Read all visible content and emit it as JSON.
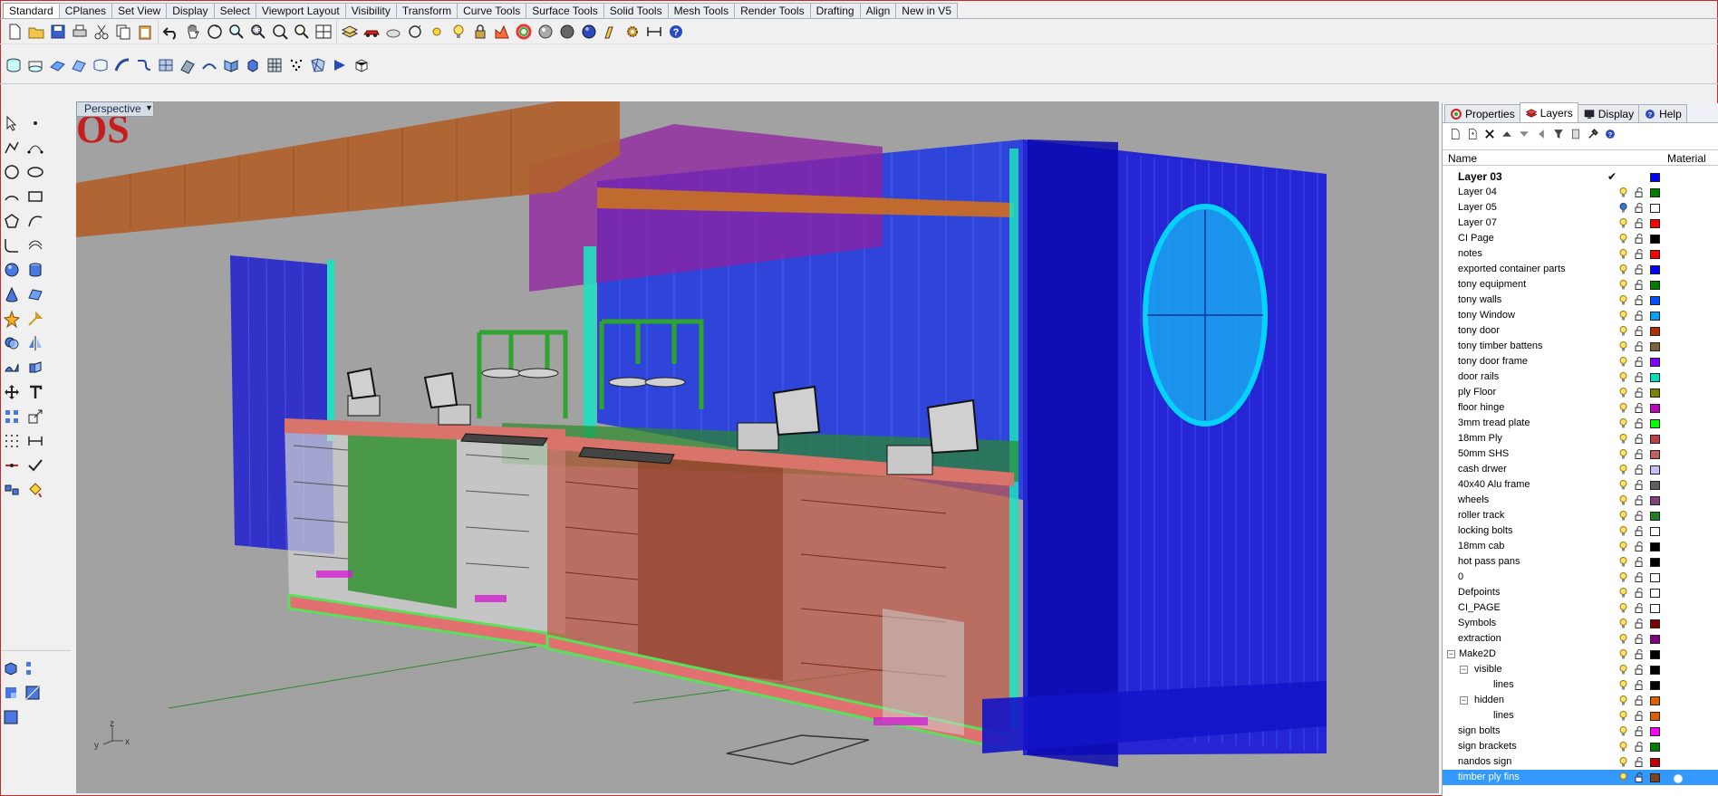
{
  "tabs": [
    "Standard",
    "CPlanes",
    "Set View",
    "Display",
    "Select",
    "Viewport Layout",
    "Visibility",
    "Transform",
    "Curve Tools",
    "Surface Tools",
    "Solid Tools",
    "Mesh Tools",
    "Render Tools",
    "Drafting",
    "Align",
    "New in V5"
  ],
  "active_tab": "Standard",
  "toolbar_row1": [
    "new-file-icon",
    "open-file-icon",
    "save-icon",
    "print-icon",
    "cut-icon",
    "copy-icon",
    "paste-icon",
    "undo-icon",
    "pan-hand-icon",
    "rotate-view-icon",
    "zoom-icon",
    "zoom-window-icon",
    "zoom-extents-icon",
    "zoom-selected-icon",
    "viewport-layout-icon",
    "layer-icon",
    "car-render-icon",
    "shade-icon",
    "rotate-icon",
    "lights-icon",
    "lightbulb-icon",
    "lock-icon",
    "analysis-icon",
    "color-wheel-icon",
    "rendered-sphere-icon",
    "shaded-sphere-icon",
    "render-icon",
    "highlight-icon",
    "settings-gear-icon",
    "dimension-icon",
    "help-icon"
  ],
  "toolbar_row2": [
    "extrude-curve-icon",
    "extrude-surface-icon",
    "plane-icon",
    "surface-patch-icon",
    "loft-icon",
    "sweep-icon",
    "blend-icon",
    "network-surface-icon",
    "unroll-icon",
    "flow-icon",
    "split-surface-icon",
    "box-icon",
    "grid-icon",
    "point-cloud-icon",
    "mesh-icon",
    "arrow-icon",
    "solid-box-icon"
  ],
  "left_tools": [
    "select-arrow-icon",
    "point-icon",
    "polyline-icon",
    "curve-points-icon",
    "circle-icon",
    "ellipse-icon",
    "arc-icon",
    "rectangle-icon",
    "polygon-icon",
    "curve-icon",
    "fillet-icon",
    "offset-icon",
    "sphere-icon",
    "cylinder-icon",
    "cone-icon",
    "surface-icon",
    "star-burst-icon",
    "arrow-pick-icon",
    "boolean-icon",
    "mirror-icon",
    "drape-icon",
    "extrude-icon",
    "move-icon",
    "text-icon",
    "array-icon",
    "scale-icon",
    "grid-snap-icon",
    "dimension-icon",
    "join-icon",
    "check-icon",
    "explode-icon",
    "paint-icon"
  ],
  "left_tools_bottom": [
    "solid-cube-icon",
    "edit-points-icon",
    "dots-icon",
    "frame-icon",
    "graph-icon"
  ],
  "viewport": {
    "title": "Perspective",
    "axis_x": "x",
    "axis_y": "y",
    "axis_z": "z"
  },
  "panel": {
    "tabs": [
      {
        "label": "Properties",
        "icon": "properties-icon"
      },
      {
        "label": "Layers",
        "icon": "layers-icon"
      },
      {
        "label": "Display",
        "icon": "display-icon"
      },
      {
        "label": "Help",
        "icon": "help-icon"
      }
    ],
    "active_tab": "Layers",
    "tools": [
      "new-layer-icon",
      "new-sublayer-icon",
      "delete-icon",
      "move-up-icon",
      "move-down-icon",
      "move-parent-icon",
      "filter-icon",
      "notes-icon",
      "tools-icon",
      "help-icon"
    ],
    "col_name": "Name",
    "col_material": "Material",
    "layers": [
      {
        "name": "Layer 03",
        "color": "#0000ff",
        "current": true,
        "indent": 0,
        "check": "✔"
      },
      {
        "name": "Layer 04",
        "color": "#008000",
        "indent": 0
      },
      {
        "name": "Layer 05",
        "color": "#ffffff",
        "indent": 0,
        "bulb_off": true
      },
      {
        "name": "Layer 07",
        "color": "#ff0000",
        "indent": 0
      },
      {
        "name": "CI Page",
        "color": "#000000",
        "indent": 0
      },
      {
        "name": "notes",
        "color": "#ff0000",
        "indent": 0
      },
      {
        "name": "exported container parts",
        "color": "#0000ff",
        "indent": 0
      },
      {
        "name": "tony equipment",
        "color": "#008000",
        "indent": 0
      },
      {
        "name": "tony walls",
        "color": "#0050ff",
        "indent": 0
      },
      {
        "name": "tony Window",
        "color": "#00a0ff",
        "indent": 0
      },
      {
        "name": "tony door",
        "color": "#b03000",
        "indent": 0
      },
      {
        "name": "tony timber battens",
        "color": "#806040",
        "indent": 0
      },
      {
        "name": "tony door frame",
        "color": "#8000ff",
        "indent": 0
      },
      {
        "name": "door rails",
        "color": "#00e0c0",
        "indent": 0
      },
      {
        "name": "ply Floor",
        "color": "#808000",
        "indent": 0
      },
      {
        "name": "floor hinge",
        "color": "#c000c0",
        "indent": 0
      },
      {
        "name": "3mm tread plate",
        "color": "#00ff00",
        "indent": 0
      },
      {
        "name": "18mm Ply",
        "color": "#c04040",
        "indent": 0
      },
      {
        "name": "50mm SHS",
        "color": "#c06060",
        "indent": 0
      },
      {
        "name": "cash drwer",
        "color": "#c0c0ff",
        "indent": 0
      },
      {
        "name": "40x40 Alu frame",
        "color": "#606060",
        "indent": 0
      },
      {
        "name": "wheels",
        "color": "#804080",
        "indent": 0
      },
      {
        "name": "roller track",
        "color": "#208020",
        "indent": 0
      },
      {
        "name": "locking bolts",
        "color": "#ffffff",
        "indent": 0
      },
      {
        "name": "18mm cab",
        "color": "#000000",
        "indent": 0
      },
      {
        "name": "hot pass pans",
        "color": "#000000",
        "indent": 0
      },
      {
        "name": "0",
        "color": "#ffffff",
        "indent": 0
      },
      {
        "name": "Defpoints",
        "color": "#ffffff",
        "indent": 0
      },
      {
        "name": "CI_PAGE",
        "color": "#ffffff",
        "indent": 0
      },
      {
        "name": "Symbols",
        "color": "#800000",
        "indent": 0
      },
      {
        "name": "extraction",
        "color": "#800080",
        "indent": 0
      },
      {
        "name": "Make2D",
        "color": "#000000",
        "indent": 0,
        "expander": "−",
        "label_offset": 20
      },
      {
        "name": "visible",
        "color": "#000000",
        "indent": 1,
        "expander": "−"
      },
      {
        "name": "lines",
        "color": "#000000",
        "indent": 2
      },
      {
        "name": "hidden",
        "color": "#e06000",
        "indent": 1,
        "expander": "−"
      },
      {
        "name": "lines",
        "color": "#e06000",
        "indent": 2
      },
      {
        "name": "sign bolts",
        "color": "#ff00ff",
        "indent": 0
      },
      {
        "name": "sign brackets",
        "color": "#008000",
        "indent": 0
      },
      {
        "name": "nandos sign",
        "color": "#c00000",
        "indent": 0
      },
      {
        "name": "timber ply fins",
        "color": "#804020",
        "indent": 0,
        "selected": true
      }
    ]
  }
}
